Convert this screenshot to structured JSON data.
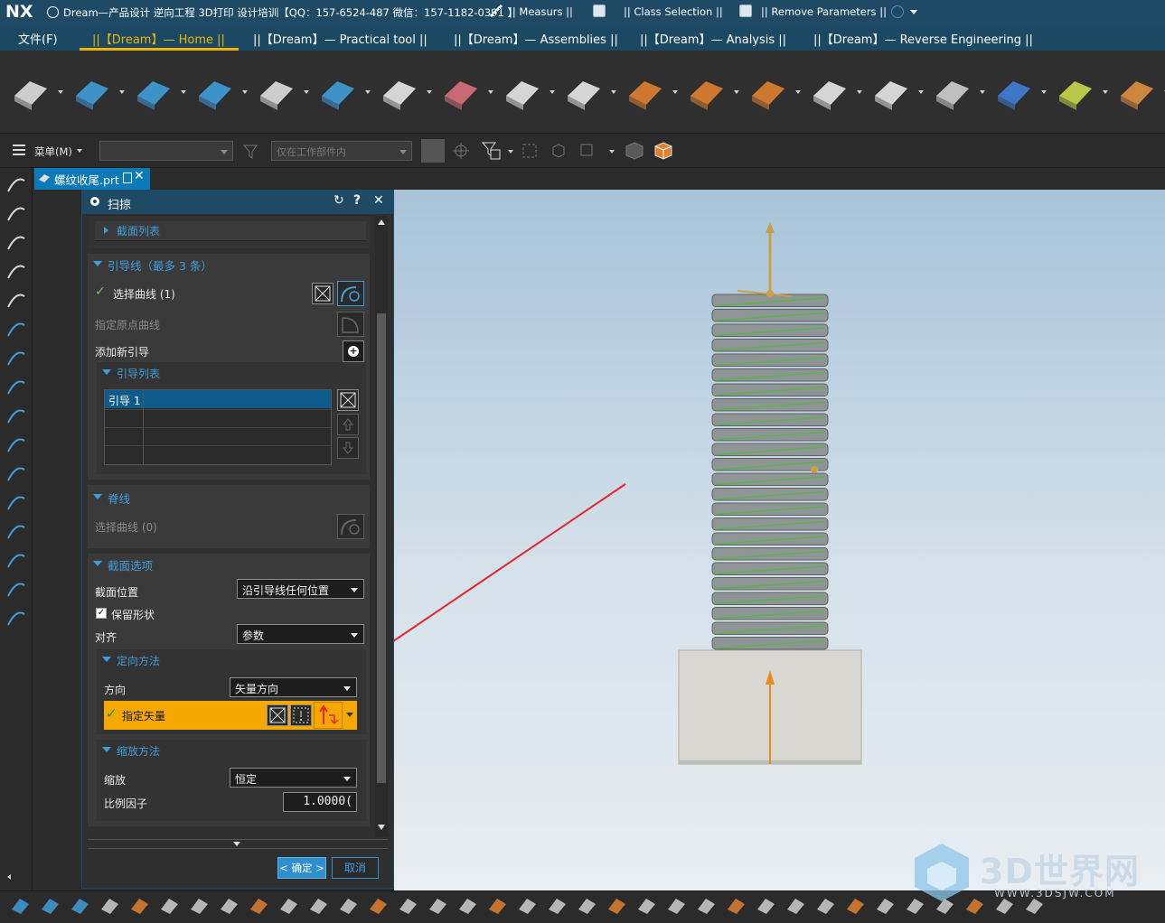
{
  "app": {
    "logo": "NX",
    "title": "Dream—产品设计 逆向工程 3D打印 设计培训【QQ：157-6524-487  微信：157-1182-0391 】",
    "quick_items": [
      "|| Measurs ||",
      "|| Class Selection ||",
      "|| Remove Parameters ||"
    ]
  },
  "ribbon_tabs": [
    "文件(F)",
    "||【Dream】— Home ||",
    "||【Dream】— Practical tool ||",
    "||【Dream】— Assemblies ||",
    "||【Dream】— Analysis ||",
    "||【Dream】— Reverse Engineering ||"
  ],
  "ribbon_icons": [
    "pmi-tool-icon",
    "circle-line-icon",
    "outline-profile-icon",
    "spline-curve-icon",
    "extrude-surface-icon",
    "curved-surface-icon",
    "bounded-plane-icon",
    "datum-csys-icon",
    "block-feature-icon",
    "cylinder-feature-icon",
    "offset-face-icon",
    "chamfer-icon",
    "thicken-icon",
    "pattern-feature-icon",
    "delete-body-icon",
    "freeform-surface-icon",
    "move-face-icon",
    "thread-tool-icon",
    "point-cloud-icon"
  ],
  "toolbar2": {
    "menu_label": "菜单(M)",
    "filter_combo": "",
    "scope_combo": "仅在工作部件内"
  },
  "file_tab": {
    "label": "螺纹收尾.prt"
  },
  "dialog": {
    "title": "扫掠",
    "section_list_label": "截面列表",
    "guide": {
      "header": "引导线（最多 3 条）",
      "select_curve": "选择曲线 (1)",
      "origin_curve": "指定原点曲线",
      "add_new": "添加新引导",
      "list_header": "引导列表",
      "list_rows": [
        "引导 1",
        "",
        "",
        ""
      ]
    },
    "spine": {
      "header": "脊线",
      "select_curve": "选择曲线 (0)"
    },
    "section_options": {
      "header": "截面选项",
      "position_label": "截面位置",
      "position_value": "沿引导线任何位置",
      "keep_shape_label": "保留形状",
      "keep_shape_checked": true,
      "align_label": "对齐",
      "align_value": "参数"
    },
    "orientation": {
      "header": "定向方法",
      "direction_label": "方向",
      "direction_value": "矢量方向",
      "vector_label": "指定矢量"
    },
    "scaling": {
      "header": "缩放方法",
      "scale_label": "缩放",
      "scale_value": "恒定",
      "factor_label": "比例因子",
      "factor_value": "1.0000("
    },
    "ok_label": "< 确定 >",
    "cancel_label": "取消"
  },
  "watermark": {
    "brand": "3D世界网",
    "url": "WWW.3DSJW.COM"
  },
  "colors": {
    "accent": "#3f9ddb",
    "highlight": "#f5a800",
    "title_bar": "#1e4a66",
    "arrow": "#e8242b",
    "helix": "#58b448"
  }
}
